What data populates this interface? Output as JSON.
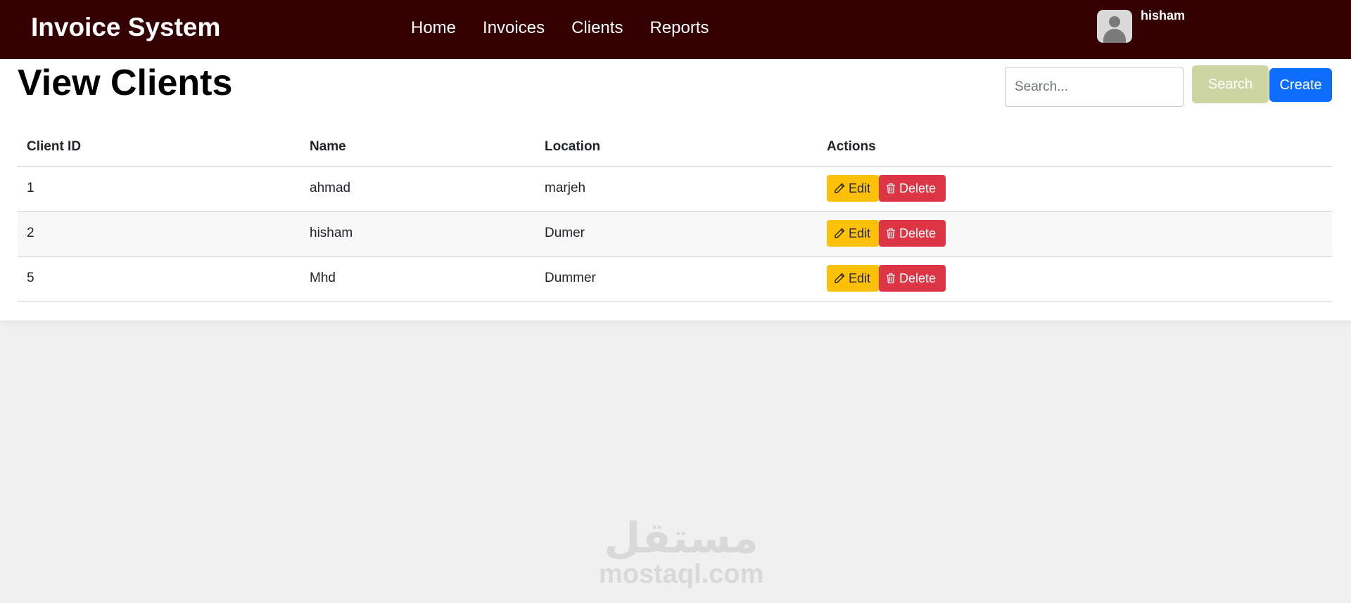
{
  "header": {
    "brand": "Invoice System",
    "nav": [
      "Home",
      "Invoices",
      "Clients",
      "Reports"
    ],
    "username": "hisham"
  },
  "page": {
    "title": "View Clients",
    "search_placeholder": "Search...",
    "search_button": "Search",
    "create_button": "Create"
  },
  "table": {
    "columns": [
      "Client ID",
      "Name",
      "Location",
      "Actions"
    ],
    "rows": [
      {
        "id": "1",
        "name": "ahmad",
        "location": "marjeh"
      },
      {
        "id": "2",
        "name": "hisham",
        "location": "Dumer"
      },
      {
        "id": "5",
        "name": "Mhd",
        "location": "Dummer"
      }
    ],
    "edit_label": "Edit",
    "delete_label": "Delete"
  },
  "watermark": {
    "arabic": "مستقل",
    "latin": "mostaql.com"
  },
  "colors": {
    "navbar": "#350002",
    "create": "#0d6efd",
    "search": "#cdd5a3",
    "edit": "#ffc107",
    "delete": "#dc3545"
  }
}
